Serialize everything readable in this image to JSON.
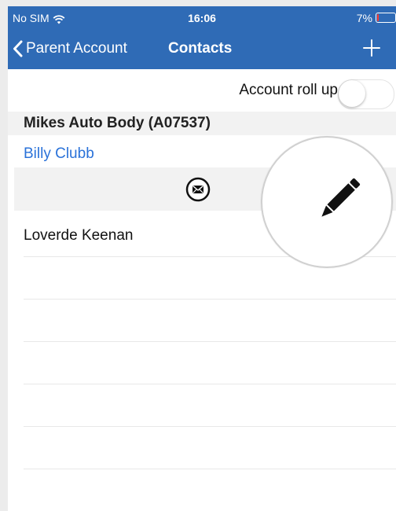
{
  "status_bar": {
    "carrier": "No SIM",
    "time": "16:06",
    "battery": "7%",
    "battery_level": 0.07
  },
  "nav": {
    "back_label": "Parent Account",
    "title": "Contacts",
    "add_icon": "plus-icon"
  },
  "rollup": {
    "label": "Account roll up",
    "enabled": false
  },
  "section": {
    "title": "Mikes Auto Body (A07537)"
  },
  "contacts": [
    {
      "name": "Billy Clubb",
      "highlighted": true
    },
    {
      "name": "Loverde Keenan",
      "highlighted": false
    }
  ],
  "row_actions": {
    "email_icon": "envelope-icon",
    "edit_icon": "pencil-icon"
  },
  "colors": {
    "nav_bar": "#2f6bb6",
    "link": "#2a72d9",
    "battery_low": "#ff3b30"
  }
}
